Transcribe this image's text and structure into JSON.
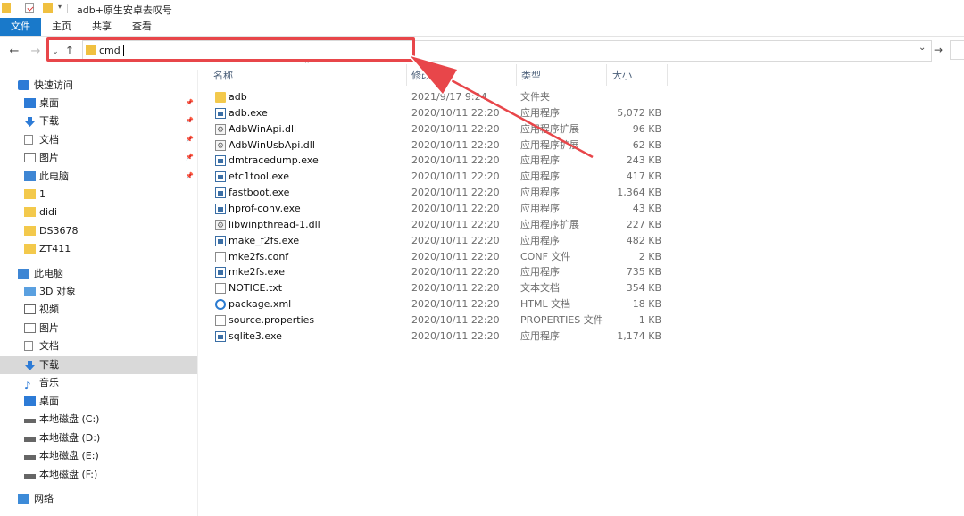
{
  "window": {
    "title": "adb+原生安卓去叹号"
  },
  "ribbon": {
    "tabs": [
      "文件",
      "主页",
      "共享",
      "查看"
    ]
  },
  "address": {
    "value": "cmd"
  },
  "sidebar": {
    "items": [
      {
        "label": "快速访问",
        "icon": "star-icon"
      },
      {
        "label": "桌面",
        "icon": "desktop-icon"
      },
      {
        "label": "下载",
        "icon": "download-icon"
      },
      {
        "label": "文档",
        "icon": "document-icon"
      },
      {
        "label": "图片",
        "icon": "pictures-icon"
      },
      {
        "label": "此电脑",
        "icon": "computer-icon"
      },
      {
        "label": "1",
        "icon": "folder-icon"
      },
      {
        "label": "didi",
        "icon": "folder-icon"
      },
      {
        "label": "DS3678",
        "icon": "folder-icon"
      },
      {
        "label": "ZT411",
        "icon": "folder-icon"
      },
      {
        "label": "此电脑",
        "icon": "computer-icon"
      },
      {
        "label": "3D 对象",
        "icon": "cube-icon"
      },
      {
        "label": "视频",
        "icon": "video-icon"
      },
      {
        "label": "图片",
        "icon": "pictures-icon"
      },
      {
        "label": "文档",
        "icon": "document-icon"
      },
      {
        "label": "下载",
        "icon": "download-icon"
      },
      {
        "label": "音乐",
        "icon": "music-icon"
      },
      {
        "label": "桌面",
        "icon": "desktop-icon"
      },
      {
        "label": "本地磁盘 (C:)",
        "icon": "drive-icon"
      },
      {
        "label": "本地磁盘 (D:)",
        "icon": "drive-icon"
      },
      {
        "label": "本地磁盘 (E:)",
        "icon": "drive-icon"
      },
      {
        "label": "本地磁盘 (F:)",
        "icon": "drive-icon"
      },
      {
        "label": "网络",
        "icon": "network-icon"
      }
    ]
  },
  "columns": {
    "name": "名称",
    "date": "修改日期",
    "type": "类型",
    "size": "大小"
  },
  "files": [
    {
      "name": "adb",
      "date": "2021/9/17 9:24",
      "type": "文件夹",
      "size": "",
      "icon": "folder"
    },
    {
      "name": "adb.exe",
      "date": "2020/10/11 22:20",
      "type": "应用程序",
      "size": "5,072 KB",
      "icon": "exe"
    },
    {
      "name": "AdbWinApi.dll",
      "date": "2020/10/11 22:20",
      "type": "应用程序扩展",
      "size": "96 KB",
      "icon": "dll"
    },
    {
      "name": "AdbWinUsbApi.dll",
      "date": "2020/10/11 22:20",
      "type": "应用程序扩展",
      "size": "62 KB",
      "icon": "dll"
    },
    {
      "name": "dmtracedump.exe",
      "date": "2020/10/11 22:20",
      "type": "应用程序",
      "size": "243 KB",
      "icon": "exe"
    },
    {
      "name": "etc1tool.exe",
      "date": "2020/10/11 22:20",
      "type": "应用程序",
      "size": "417 KB",
      "icon": "exe"
    },
    {
      "name": "fastboot.exe",
      "date": "2020/10/11 22:20",
      "type": "应用程序",
      "size": "1,364 KB",
      "icon": "exe"
    },
    {
      "name": "hprof-conv.exe",
      "date": "2020/10/11 22:20",
      "type": "应用程序",
      "size": "43 KB",
      "icon": "exe"
    },
    {
      "name": "libwinpthread-1.dll",
      "date": "2020/10/11 22:20",
      "type": "应用程序扩展",
      "size": "227 KB",
      "icon": "dll"
    },
    {
      "name": "make_f2fs.exe",
      "date": "2020/10/11 22:20",
      "type": "应用程序",
      "size": "482 KB",
      "icon": "exe"
    },
    {
      "name": "mke2fs.conf",
      "date": "2020/10/11 22:20",
      "type": "CONF 文件",
      "size": "2 KB",
      "icon": "doc"
    },
    {
      "name": "mke2fs.exe",
      "date": "2020/10/11 22:20",
      "type": "应用程序",
      "size": "735 KB",
      "icon": "exe"
    },
    {
      "name": "NOTICE.txt",
      "date": "2020/10/11 22:20",
      "type": "文本文档",
      "size": "354 KB",
      "icon": "doc"
    },
    {
      "name": "package.xml",
      "date": "2020/10/11 22:20",
      "type": "HTML 文档",
      "size": "18 KB",
      "icon": "xml"
    },
    {
      "name": "source.properties",
      "date": "2020/10/11 22:20",
      "type": "PROPERTIES 文件",
      "size": "1 KB",
      "icon": "doc"
    },
    {
      "name": "sqlite3.exe",
      "date": "2020/10/11 22:20",
      "type": "应用程序",
      "size": "1,174 KB",
      "icon": "exe"
    }
  ],
  "colors": {
    "accent": "#1979ca",
    "annotation": "#e8464a",
    "folder": "#f3c94c"
  }
}
